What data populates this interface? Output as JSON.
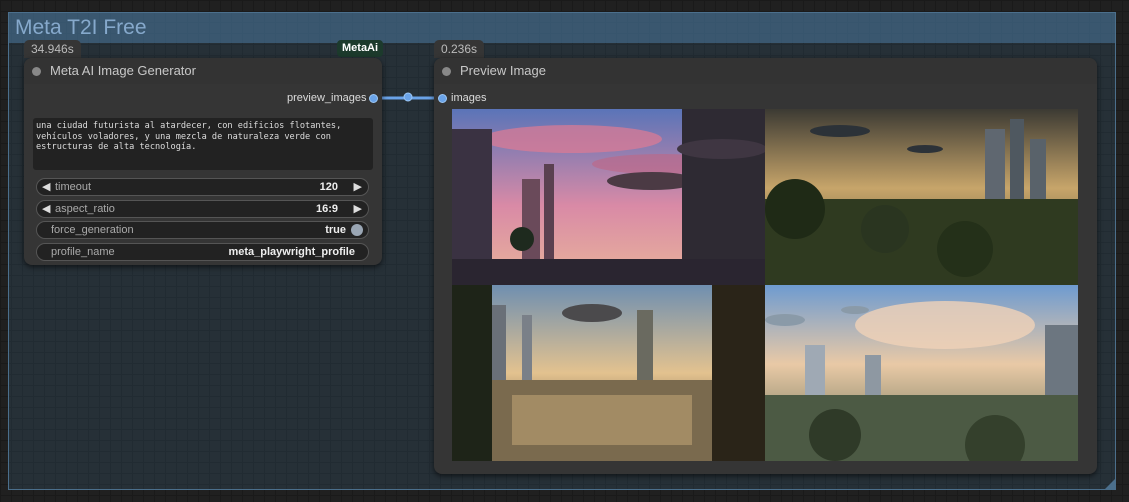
{
  "group": {
    "title": "Meta T2I Free"
  },
  "generator": {
    "timing": "34.946s",
    "badge": "MetaAi",
    "title": "Meta AI Image Generator",
    "output_label": "preview_images",
    "prompt": "una ciudad futurista al atardecer, con edificios flotantes, vehículos voladores, y una mezcla de naturaleza verde con estructuras de alta tecnología.",
    "widgets": {
      "timeout": {
        "label": "timeout",
        "value": "120"
      },
      "aspect_ratio": {
        "label": "aspect_ratio",
        "value": "16:9"
      },
      "force_generation": {
        "label": "force_generation",
        "value": "true"
      },
      "profile_name": {
        "label": "profile_name",
        "value": "meta_playwright_profile"
      }
    }
  },
  "preview": {
    "timing": "0.236s",
    "title": "Preview Image",
    "input_label": "images",
    "images": [
      {
        "scene": "futuristic city at sunset with pink clouds and flying vehicles"
      },
      {
        "scene": "golden-hour city with jungle and airships"
      },
      {
        "scene": "river city with tall spires and hovering airship"
      },
      {
        "scene": "sunlit skyline with clouds and flying craft"
      }
    ]
  },
  "colors": {
    "link": "#6aa3e8",
    "group_border": "#4b6f8c",
    "node_bg": "#353535"
  }
}
